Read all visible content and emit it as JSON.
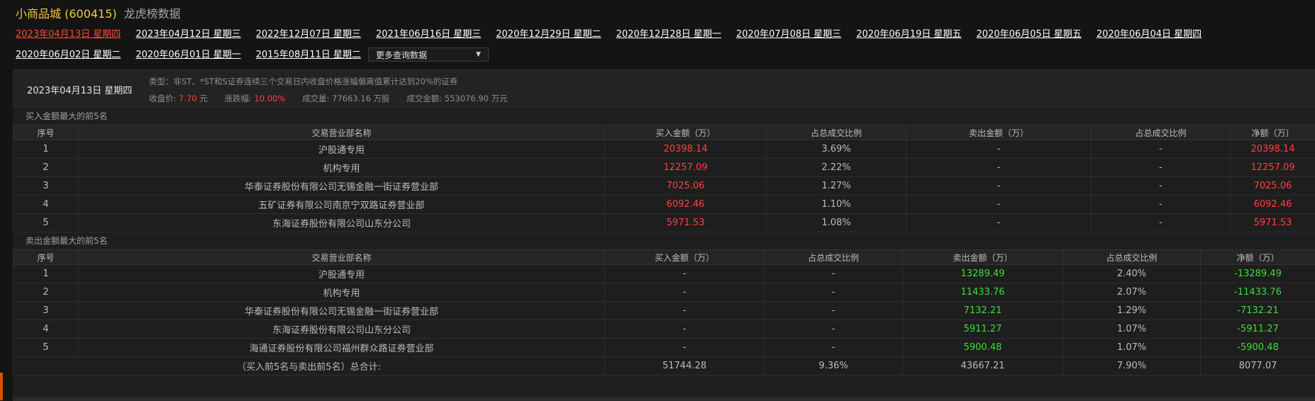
{
  "header": {
    "stock_name": "小商品城 (600415)",
    "title": "龙虎榜数据"
  },
  "date_nav": {
    "dates": [
      "2023年04月13日 星期四",
      "2023年04月12日 星期三",
      "2022年12月07日 星期三",
      "2021年06月16日 星期三",
      "2020年12月29日 星期二",
      "2020年12月28日 星期一",
      "2020年07月08日 星期三",
      "2020年06月19日 星期五",
      "2020年06月05日 星期五",
      "2020年06月04日 星期四",
      "2020年06月02日 星期二",
      "2020年06月01日 星期一",
      "2015年08月11日 星期二"
    ],
    "active_index": 0,
    "more_label": "更多查询数据"
  },
  "info": {
    "date": "2023年04月13日 星期四",
    "type_text": "类型：非ST、*ST和S证券连续三个交易日内收盘价格涨幅偏离值累计达到20%的证券",
    "close_label": "收盘价:",
    "close_value": "7.70",
    "close_unit": "元",
    "change_label": "涨跌幅:",
    "change_value": "10.00%",
    "volume_label": "成交量:",
    "volume_value": "77663.16 万股",
    "amount_label": "成交金额:",
    "amount_value": "553076.90 万元"
  },
  "buy_section": {
    "title": "买入金额最大的前5名",
    "headers": [
      "序号",
      "交易营业部名称",
      "买入金额（万）",
      "占总成交比例",
      "卖出金额（万）",
      "占总成交比例",
      "净额（万）"
    ],
    "rows": [
      [
        "1",
        "沪股通专用",
        "20398.14",
        "3.69%",
        "-",
        "-",
        "20398.14"
      ],
      [
        "2",
        "机构专用",
        "12257.09",
        "2.22%",
        "-",
        "-",
        "12257.09"
      ],
      [
        "3",
        "华泰证券股份有限公司无锡金融一街证券营业部",
        "7025.06",
        "1.27%",
        "-",
        "-",
        "7025.06"
      ],
      [
        "4",
        "五矿证券有限公司南京宁双路证券营业部",
        "6092.46",
        "1.10%",
        "-",
        "-",
        "6092.46"
      ],
      [
        "5",
        "东海证券股份有限公司山东分公司",
        "5971.53",
        "1.08%",
        "-",
        "-",
        "5971.53"
      ]
    ]
  },
  "sell_section": {
    "title": "卖出金额最大的前5名",
    "headers": [
      "序号",
      "交易营业部名称",
      "买入金额（万）",
      "占总成交比例",
      "卖出金额（万）",
      "占总成交比例",
      "净额（万）"
    ],
    "rows": [
      [
        "1",
        "沪股通专用",
        "-",
        "-",
        "13289.49",
        "2.40%",
        "-13289.49"
      ],
      [
        "2",
        "机构专用",
        "-",
        "-",
        "11433.76",
        "2.07%",
        "-11433.76"
      ],
      [
        "3",
        "华泰证券股份有限公司无锡金融一街证券营业部",
        "-",
        "-",
        "7132.21",
        "1.29%",
        "-7132.21"
      ],
      [
        "4",
        "东海证券股份有限公司山东分公司",
        "-",
        "-",
        "5911.27",
        "1.07%",
        "-5911.27"
      ],
      [
        "5",
        "海通证券股份有限公司福州群众路证券营业部",
        "-",
        "-",
        "5900.48",
        "1.07%",
        "-5900.48"
      ]
    ],
    "total": [
      "（买入前5名与卖出前5名）总合计:",
      "51744.28",
      "9.36%",
      "43667.21",
      "7.90%",
      "8077.07"
    ]
  },
  "colors": {
    "up": "#ff4040",
    "down": "#3ddc3d",
    "active_date": "#ff4a2f",
    "stock_name": "#f5c842"
  }
}
